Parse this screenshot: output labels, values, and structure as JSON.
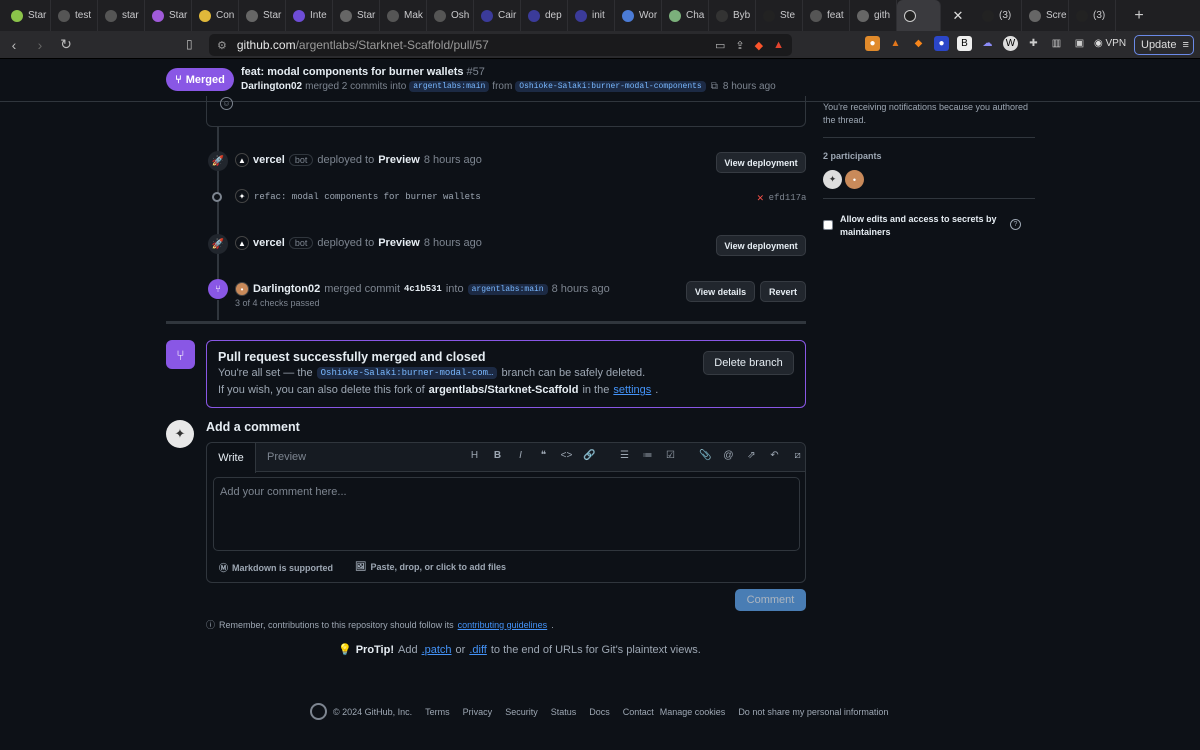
{
  "browser": {
    "tabs": [
      {
        "label": "Star",
        "color": "#8bc34a",
        "icon": "smile-icon"
      },
      {
        "label": "test",
        "color": "#555",
        "icon": "github-icon"
      },
      {
        "label": "star",
        "color": "#555",
        "icon": "github-icon"
      },
      {
        "label": "Star",
        "color": "#a05ad9",
        "icon": "starknet-icon"
      },
      {
        "label": "Con",
        "color": "#e0b83a",
        "icon": "smile-icon"
      },
      {
        "label": "Star",
        "color": "#666",
        "icon": "globe-icon"
      },
      {
        "label": "Inte",
        "color": "#6e4dd6",
        "icon": "wave-icon"
      },
      {
        "label": "Star",
        "color": "#666",
        "icon": "globe-icon"
      },
      {
        "label": "Mak",
        "color": "#555",
        "icon": "github-icon"
      },
      {
        "label": "Osh",
        "color": "#555",
        "icon": "github-icon"
      },
      {
        "label": "Cair",
        "color": "#3b3b9a",
        "icon": "x-mark-icon"
      },
      {
        "label": "dep",
        "color": "#3b3b9a",
        "icon": "x-mark-icon"
      },
      {
        "label": "init",
        "color": "#3b3b9a",
        "icon": "x-mark-icon"
      },
      {
        "label": "Wor",
        "color": "#4b7bd6",
        "icon": "cube-icon"
      },
      {
        "label": "Cha",
        "color": "#7bb07b",
        "icon": "doc-icon"
      },
      {
        "label": "Byb",
        "color": "#333",
        "icon": "dots-icon"
      },
      {
        "label": "Ste",
        "color": "#222",
        "icon": "pill-icon"
      },
      {
        "label": "feat",
        "color": "#555",
        "icon": "github-icon"
      },
      {
        "label": "gith",
        "color": "#666",
        "icon": "google-icon"
      }
    ],
    "tabs_after": [
      {
        "label": "(3)",
        "color": "#222",
        "icon": "x-logo-icon"
      },
      {
        "label": "Scre",
        "color": "#666",
        "icon": "globe-icon"
      },
      {
        "label": "(3)",
        "color": "#222",
        "icon": "x-logo-icon"
      }
    ],
    "url_host": "github.com",
    "url_path": "/argentlabs/Starknet-Scaffold/pull/57",
    "vpn_label": "VPN",
    "update_label": "Update"
  },
  "header": {
    "state_label": "Merged",
    "title": "feat: modal components for burner wallets",
    "number": "#57",
    "author": "Darlington02",
    "merged_text": "merged 2 commits into",
    "base_ref": "argentlabs:main",
    "from_text": "from",
    "head_ref": "Oshioke-Salaki:burner-modal-components",
    "time": "8 hours ago"
  },
  "timeline": {
    "deploy1": {
      "actor": "vercel",
      "bot": "bot",
      "text": "deployed to",
      "env": "Preview",
      "time": "8 hours ago",
      "button": "View deployment"
    },
    "commit": {
      "message": "refac: modal components for burner wallets",
      "sha": "efd117a",
      "status": "✕"
    },
    "deploy2": {
      "actor": "vercel",
      "bot": "bot",
      "text": "deployed to",
      "env": "Preview",
      "time": "8 hours ago",
      "button": "View deployment"
    },
    "merge": {
      "actor": "Darlington02",
      "text": "merged commit",
      "sha": "4c1b531",
      "into": "into",
      "ref": "argentlabs:main",
      "time": "8 hours ago",
      "checks": "3 of 4 checks passed",
      "details_button": "View details",
      "revert_button": "Revert"
    }
  },
  "merged_box": {
    "title": "Pull request successfully merged and closed",
    "line1_pre": "You're all set — the",
    "branch": "Oshioke-Salaki:burner-modal-com…",
    "line1_post": "branch can be safely deleted.",
    "line2_pre": "If you wish, you can also delete this fork of",
    "repo": "argentlabs/Starknet-Scaffold",
    "line2_mid": "in the",
    "settings": "settings",
    "line2_end": ".",
    "delete_button": "Delete branch"
  },
  "composer": {
    "heading": "Add a comment",
    "tab_write": "Write",
    "tab_preview": "Preview",
    "placeholder": "Add your comment here...",
    "markdown_note": "Markdown is supported",
    "attach_note": "Paste, drop, or click to add files",
    "submit": "Comment",
    "toolbar_icons": [
      "heading-icon",
      "bold-icon",
      "italic-icon",
      "quote-icon",
      "code-icon",
      "link-icon",
      "ordered-list-icon",
      "unordered-list-icon",
      "task-list-icon",
      "attach-icon",
      "mention-icon",
      "cross-reference-icon",
      "reply-icon",
      "slash-command-icon"
    ]
  },
  "notes": {
    "remember_pre": "Remember, contributions to this repository should follow its",
    "remember_link": "contributing guidelines",
    "remember_end": ".",
    "protip_label": "ProTip!",
    "protip_pre": "Add",
    "patch": ".patch",
    "or": "or",
    "diff": ".diff",
    "protip_post": "to the end of URLs for Git's plaintext views."
  },
  "footer": {
    "copyright": "© 2024 GitHub, Inc.",
    "links": [
      "Terms",
      "Privacy",
      "Security",
      "Status",
      "Docs",
      "Contact",
      "Manage cookies",
      "Do not share my personal information"
    ]
  },
  "sidebar": {
    "notify_text": "You're receiving notifications because you authored the thread.",
    "participants_label": "2 participants",
    "allow_edits": "Allow edits and access to secrets by maintainers"
  },
  "colors": {
    "merged": "#8957e5",
    "link": "#4493f8",
    "background": "#0d1117"
  }
}
